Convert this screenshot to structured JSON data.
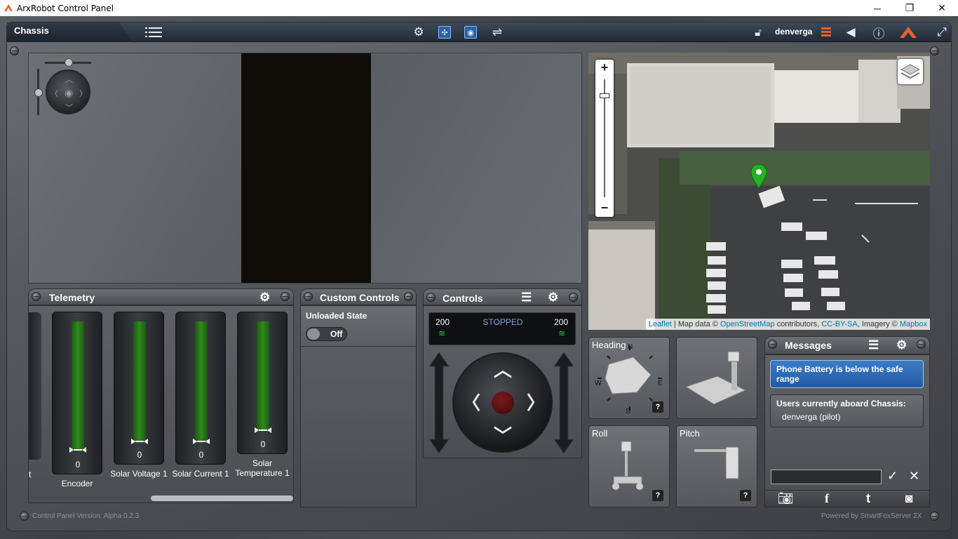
{
  "window": {
    "title": "ArxRobot Control Panel",
    "minimize": "─",
    "maximize": "❐",
    "close": "✕"
  },
  "toolbar": {
    "robot_name": "Chassis",
    "username": "denverga"
  },
  "map": {
    "zoom_in": "+",
    "zoom_out": "−",
    "attribution": {
      "leaflet": "Leaflet",
      "sep1": " | Map data © ",
      "osm": "OpenStreetMap",
      "sep2": " contributors, ",
      "license": "CC-BY-SA",
      "sep3": ", Imagery © ",
      "imagery": "Mapbox"
    }
  },
  "telemetry": {
    "title": "Telemetry",
    "partial_label": "t",
    "gauges": [
      {
        "label": "Encoder",
        "value": "0",
        "fill": 1.0
      },
      {
        "label": "Solar Voltage 1",
        "value": "0",
        "fill": 1.0
      },
      {
        "label": "Solar Current 1",
        "value": "0",
        "fill": 1.0
      },
      {
        "label": "Solar Temperature 1",
        "value": "0",
        "fill": 1.0
      }
    ]
  },
  "custom_controls": {
    "title": "Custom Controls",
    "item_label": "Unloaded State",
    "toggle_text": "Off"
  },
  "controls": {
    "title": "Controls",
    "left_speed": "200",
    "right_speed": "200",
    "state": "STOPPED"
  },
  "attitude": {
    "heading_label": "Heading",
    "roll_label": "Roll",
    "pitch_label": "Pitch",
    "help": "?",
    "compass": {
      "n": "N",
      "s": "S",
      "e": "E",
      "w": "W"
    }
  },
  "messages": {
    "title": "Messages",
    "alert": "Phone Battery is below the safe range",
    "users_heading": "Users currently aboard Chassis:",
    "users": [
      "denverga (pilot)"
    ],
    "input_placeholder": "",
    "send": "✓",
    "clear": "✕"
  },
  "footer": {
    "version": "Control Panel Version: Alpha 0.2.3",
    "powered": "Powered by SmartFoxServer 2X"
  },
  "colors": {
    "alert_blue": "#2d6bb5",
    "gauge_green": "#2f8a1c",
    "map_marker": "#22b322",
    "accent_orange": "#e8612a"
  }
}
